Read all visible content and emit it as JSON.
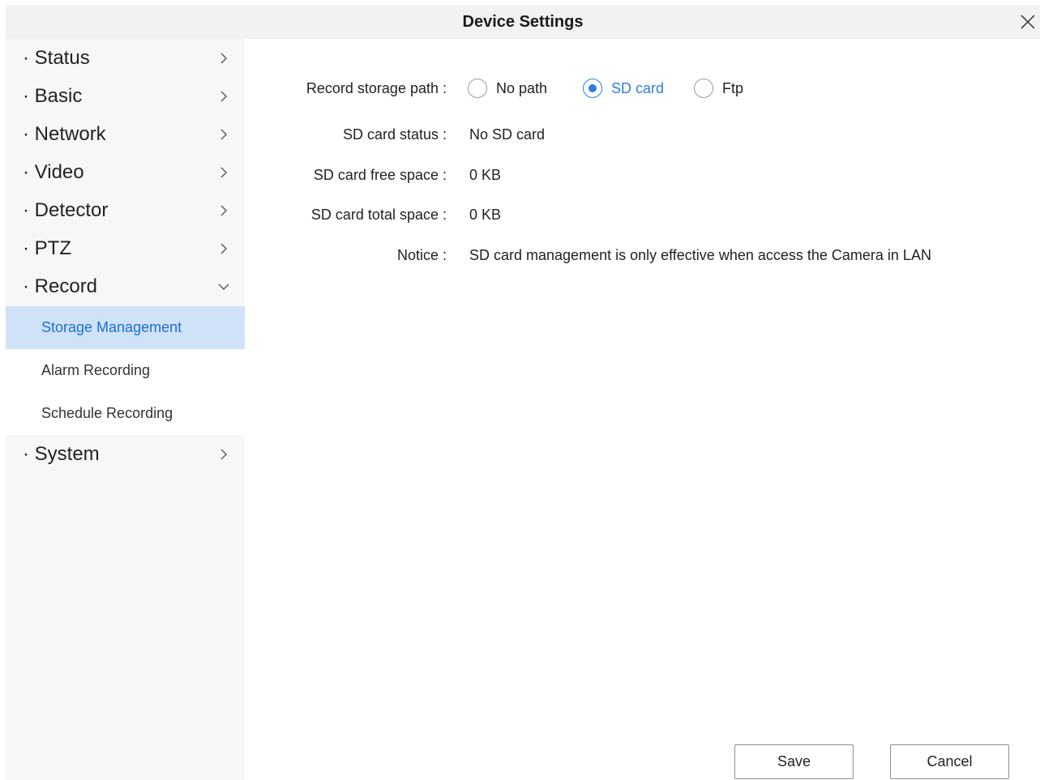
{
  "window": {
    "title": "Device Settings",
    "close_icon": "close-icon"
  },
  "sidebar": {
    "items": [
      {
        "label": "· Status",
        "icon": "chevron-right-icon"
      },
      {
        "label": "· Basic",
        "icon": "chevron-right-icon"
      },
      {
        "label": "· Network",
        "icon": "chevron-right-icon"
      },
      {
        "label": "· Video",
        "icon": "chevron-right-icon"
      },
      {
        "label": "· Detector",
        "icon": "chevron-right-icon"
      },
      {
        "label": "· PTZ",
        "icon": "chevron-right-icon"
      },
      {
        "label": "· Record",
        "icon": "chevron-down-icon",
        "expanded": true
      },
      {
        "label": "· System",
        "icon": "chevron-right-icon"
      }
    ],
    "record_subitems": [
      {
        "label": "Storage Management",
        "active": true
      },
      {
        "label": "Alarm Recording",
        "active": false
      },
      {
        "label": "Schedule Recording",
        "active": false
      }
    ]
  },
  "form": {
    "storage_path": {
      "label": "Record storage path :",
      "options": [
        "No path",
        "SD card",
        "Ftp"
      ],
      "selected": "SD card"
    },
    "sd_status": {
      "label": "SD card status :",
      "value": "No SD card"
    },
    "sd_free": {
      "label": "SD card free space :",
      "value": "0 KB"
    },
    "sd_total": {
      "label": "SD card total space :",
      "value": "0 KB"
    },
    "notice": {
      "label": "Notice :",
      "value": "SD card management is only effective when access the Camera in LAN"
    }
  },
  "buttons": {
    "save": "Save",
    "cancel": "Cancel"
  },
  "colors": {
    "accent": "#2a7fe0",
    "active_bg": "#cfe2f8",
    "sidebar_bg": "#f7f7f7",
    "titlebar_bg": "#f2f2f2"
  }
}
